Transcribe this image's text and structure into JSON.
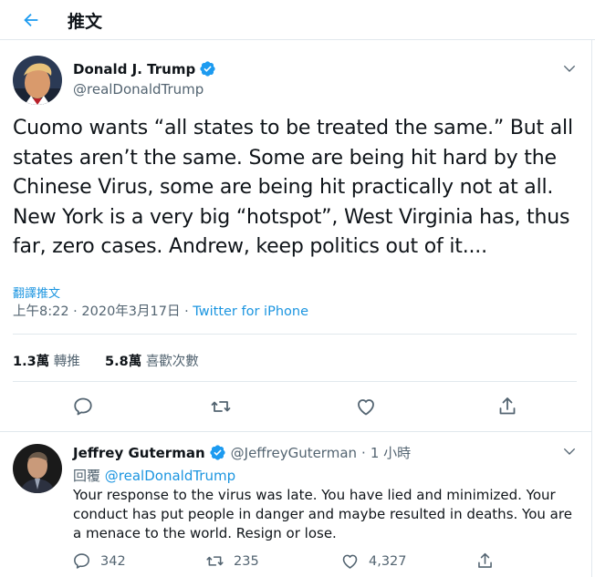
{
  "header": {
    "title": "推文"
  },
  "tweet": {
    "display_name": "Donald J. Trump",
    "handle": "@realDonaldTrump",
    "text": "Cuomo wants “all states to be treated the same.” But all states aren’t the same. Some are being hit hard by the Chinese Virus, some are being hit practically not at all. New York is a very big “hotspot”, West Virginia has, thus far, zero cases. Andrew, keep politics out of it....",
    "translate_label": "翻譯推文",
    "time": "上午8:22",
    "date": "2020年3月17日",
    "sep": "·",
    "source": "Twitter for iPhone",
    "retweets_count": "1.3萬",
    "retweets_label": "轉推",
    "likes_count": "5.8萬",
    "likes_label": "喜歡次數"
  },
  "reply": {
    "display_name": "Jeffrey Guterman",
    "handle": "@JeffreyGuterman",
    "sep": "·",
    "age": "1 小時",
    "replying_label": "回覆",
    "replying_to": "@realDonaldTrump",
    "text": "Your response to the virus was late. You have lied and minimized. Your conduct has put people in danger and maybe resulted in deaths. You are a menace to the world. Resign or lose.",
    "reply_count": "342",
    "retweet_count": "235",
    "like_count": "4,327"
  },
  "icons": {
    "back": "arrow-left-icon",
    "verified": "verified-badge-icon",
    "more": "chevron-down-icon",
    "reply": "reply-icon",
    "retweet": "retweet-icon",
    "like": "heart-icon",
    "share": "share-icon"
  },
  "colors": {
    "accent": "#1b95e0",
    "verified": "#1d9bf0",
    "muted": "#536471",
    "divider": "#e1e8ed"
  }
}
